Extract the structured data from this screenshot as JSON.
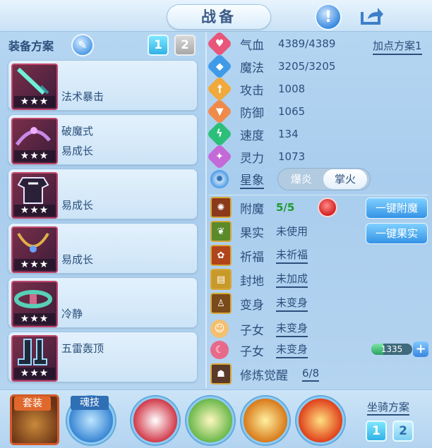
{
  "header": {
    "title": "战备"
  },
  "left": {
    "section_label": "装备方案",
    "plan_buttons": [
      "1",
      "2"
    ],
    "cards": [
      {
        "stars": "★★★",
        "line1": "",
        "line2": "法术暴击"
      },
      {
        "stars": "★★★",
        "line1": "破魔式",
        "line2": "易成长"
      },
      {
        "stars": "★★★",
        "line1": "",
        "line2": "易成长"
      },
      {
        "stars": "★★★",
        "line1": "",
        "line2": "易成长"
      },
      {
        "stars": "★★★",
        "line1": "",
        "line2": "冷静"
      },
      {
        "stars": "★★★",
        "line1": "五雷轰顶",
        "line2": ""
      }
    ]
  },
  "stats": {
    "add_point_label": "加点方案1",
    "rows": [
      {
        "name": "气血",
        "value": "4389/4389",
        "color": "#e8567a"
      },
      {
        "name": "魔法",
        "value": "3205/3205",
        "color": "#3f9be8"
      },
      {
        "name": "攻击",
        "value": "1008",
        "color": "#f0a93a"
      },
      {
        "name": "防御",
        "value": "1065",
        "color": "#f08a4a"
      },
      {
        "name": "速度",
        "value": "134",
        "color": "#2cbf7a"
      },
      {
        "name": "灵力",
        "value": "1073",
        "color": "#c46ad8"
      }
    ],
    "star_label": "星象",
    "star_options": [
      "爆炎",
      "掌火"
    ]
  },
  "extras": {
    "enchant": {
      "name": "附魔",
      "value": "5/5"
    },
    "fruit": {
      "name": "果实",
      "value": "未使用"
    },
    "bless": {
      "name": "祈福",
      "value": "未祈福"
    },
    "seal": {
      "name": "封地",
      "value": "未加成"
    },
    "transform": {
      "name": "变身",
      "value": "未变身"
    },
    "child1": {
      "name": "子女",
      "value": "未变身"
    },
    "child2": {
      "name": "子女",
      "value": "未变身"
    },
    "awaken": {
      "name": "修炼觉醒",
      "value": "6/8"
    },
    "btn_enchant": "一键附魔",
    "btn_fruit": "一键果实",
    "progress_value": "1335",
    "progress_fraction": 0.3,
    "plus": "+"
  },
  "bottom": {
    "suit_label": "套装",
    "soul_label": "魂技",
    "mount_label": "坐骑方案",
    "mount_buttons": [
      "1",
      "2"
    ]
  }
}
